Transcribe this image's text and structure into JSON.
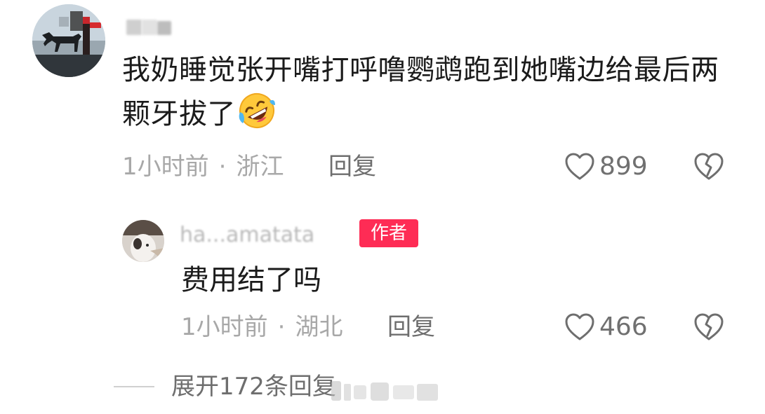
{
  "comment": {
    "username": "",
    "text": "我奶睡觉张开嘴打呼噜鹦鹉跑到她嘴边给最后两颗牙拔了",
    "emoji_icon": "rolling-on-floor-laughing-emoji",
    "time": "1小时前",
    "separator": "·",
    "location": "浙江",
    "reply_label": "回复",
    "like_count": "899"
  },
  "reply": {
    "username": "ha...amatata",
    "badge": "作者",
    "text": "费用结了吗",
    "time": "1小时前",
    "separator": "·",
    "location": "湖北",
    "reply_label": "回复",
    "like_count": "466"
  },
  "expand": {
    "label": "展开172条回复"
  },
  "colors": {
    "author_badge": "#fe2c55",
    "text_primary": "#1b1b1b",
    "text_meta": "#a8a8a8"
  }
}
